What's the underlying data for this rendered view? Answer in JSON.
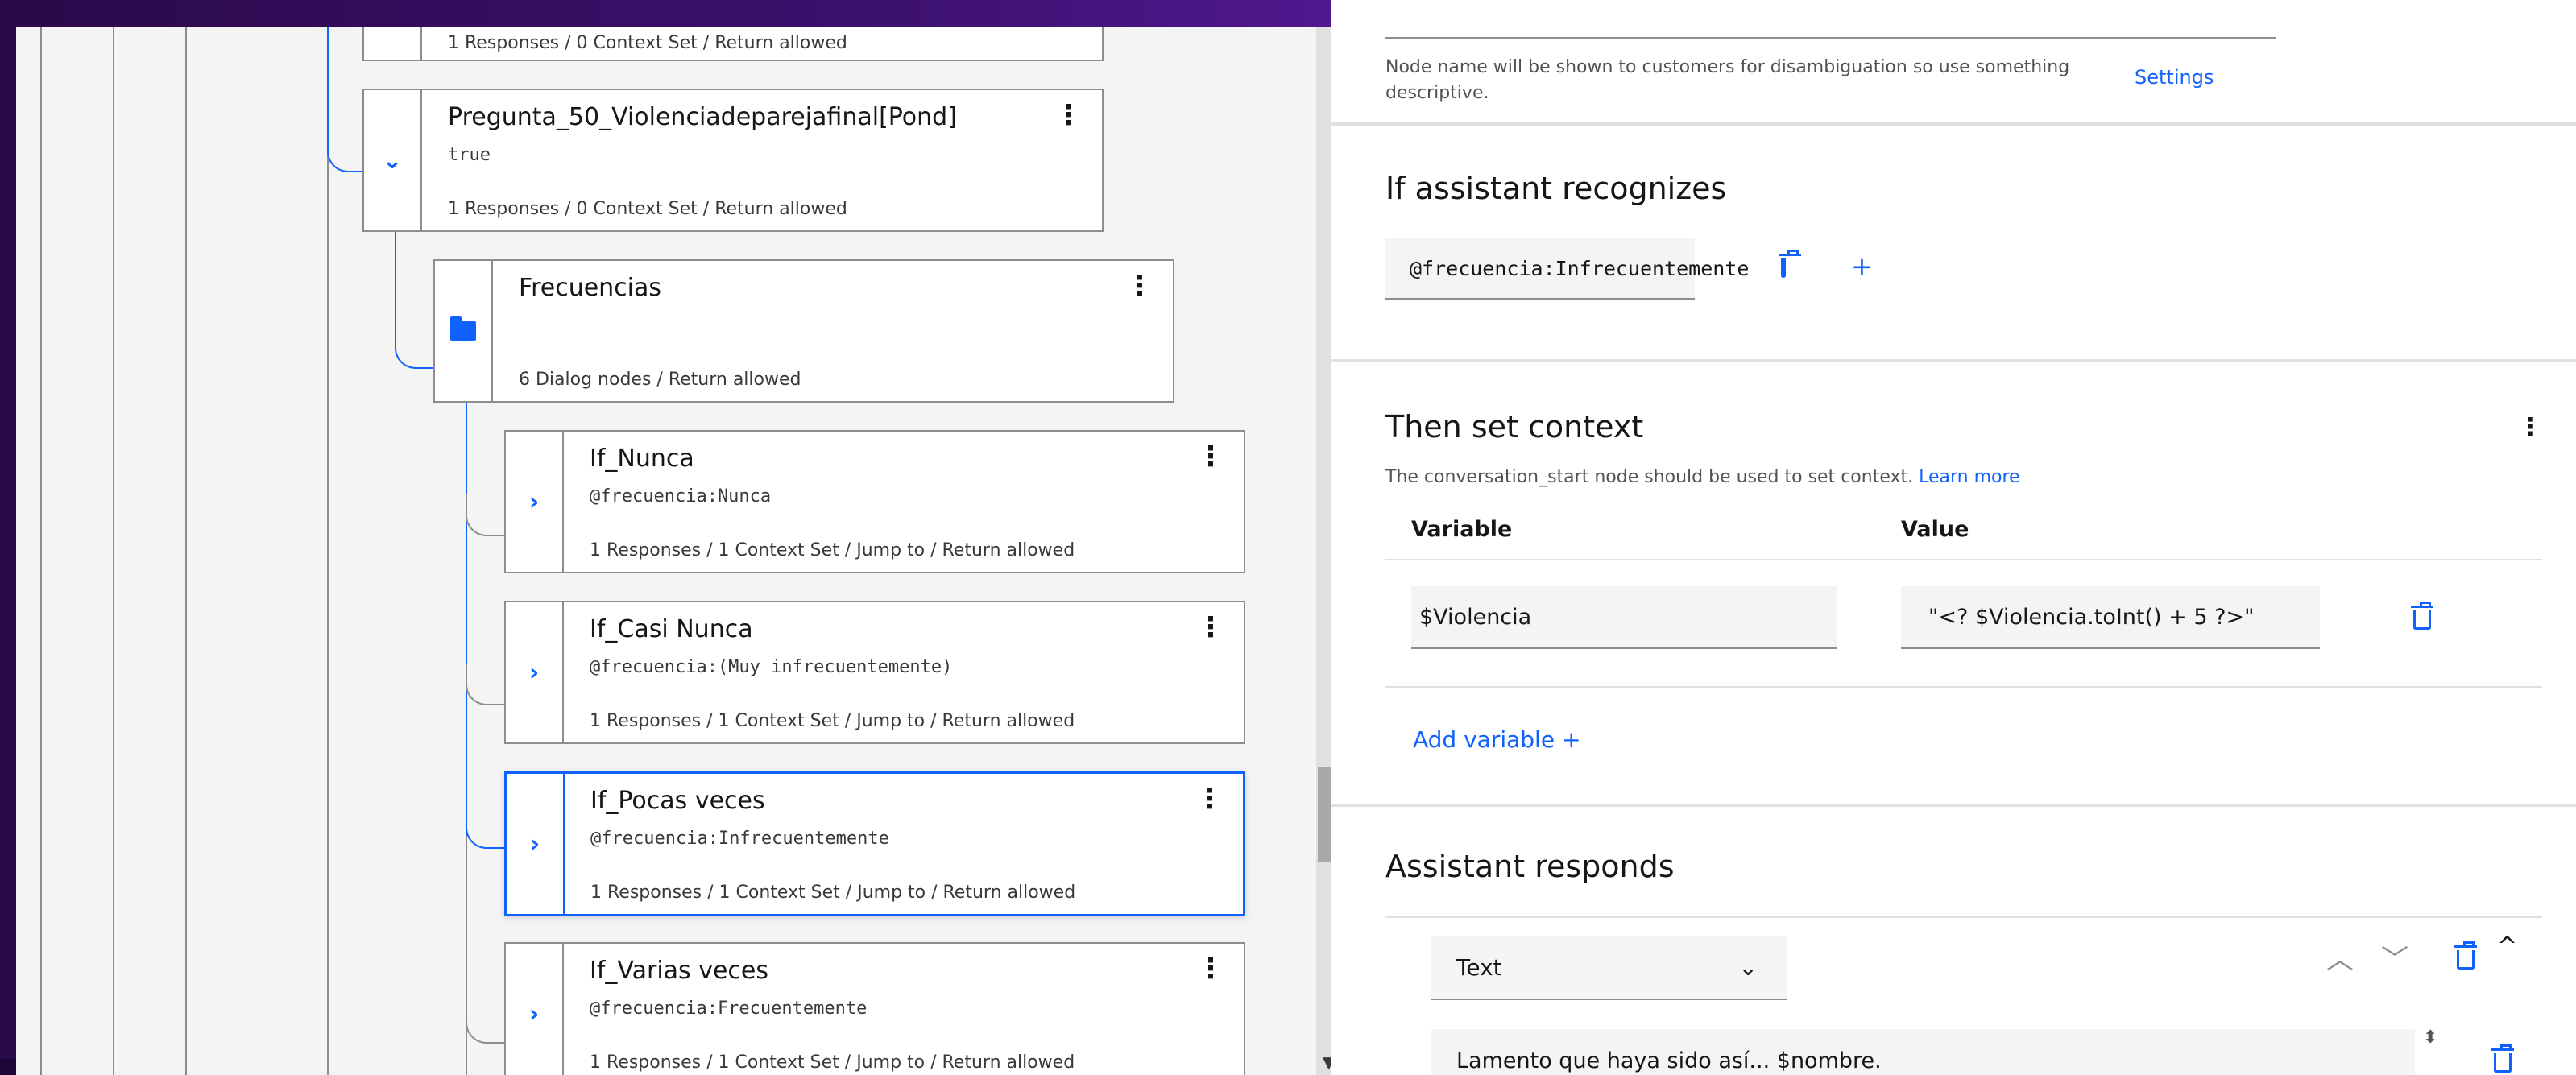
{
  "tree": {
    "top_partial_meta": "1 Responses / 0 Context Set / Return allowed",
    "nodes": [
      {
        "title": "Pregunta_50_Violenciadeparejafinal[Pond]",
        "condition": "true",
        "meta": "1 Responses / 0 Context Set / Return allowed",
        "toggle": "chevron-down"
      },
      {
        "title": "Frecuencias",
        "condition": "",
        "meta": "6 Dialog nodes / Return allowed",
        "toggle": "folder"
      },
      {
        "title": "If_Nunca",
        "condition": "@frecuencia:Nunca",
        "meta": "1 Responses / 1 Context Set / Jump to / Return allowed",
        "toggle": "chevron-right"
      },
      {
        "title": "If_Casi Nunca",
        "condition": "@frecuencia:(Muy infrecuentemente)",
        "meta": "1 Responses / 1 Context Set / Jump to / Return allowed",
        "toggle": "chevron-right"
      },
      {
        "title": "If_Pocas veces",
        "condition": "@frecuencia:Infrecuentemente",
        "meta": "1 Responses / 1 Context Set / Jump to / Return allowed",
        "toggle": "chevron-right",
        "selected": true
      },
      {
        "title": "If_Varias veces",
        "condition": "@frecuencia:Frecuentemente",
        "meta": "1 Responses / 1 Context Set / Jump to / Return allowed",
        "toggle": "chevron-right"
      }
    ]
  },
  "editor": {
    "node_name_help": "Node name will be shown to customers for disambiguation so use something descriptive.",
    "settings_link": "Settings",
    "recognizes": {
      "title": "If assistant recognizes",
      "condition_chip": "@frecuencia:Infrecuentemente"
    },
    "context": {
      "title": "Then set context",
      "help": "The conversation_start node should be used to set context.",
      "learn_more": "Learn more",
      "col_variable": "Variable",
      "col_value": "Value",
      "variable": "$Violencia",
      "value": "\"<? $Violencia.toInt() + 5 ?>\"",
      "add_variable": "Add variable"
    },
    "responds": {
      "title": "Assistant responds",
      "response_type": "Text",
      "response_text": "Lamento que haya sido así... $nombre."
    }
  },
  "colors": {
    "accent": "#0f62fe",
    "border": "#8d8d8d",
    "field_bg": "#f4f4f4",
    "wallpaper": "#3d1170"
  }
}
